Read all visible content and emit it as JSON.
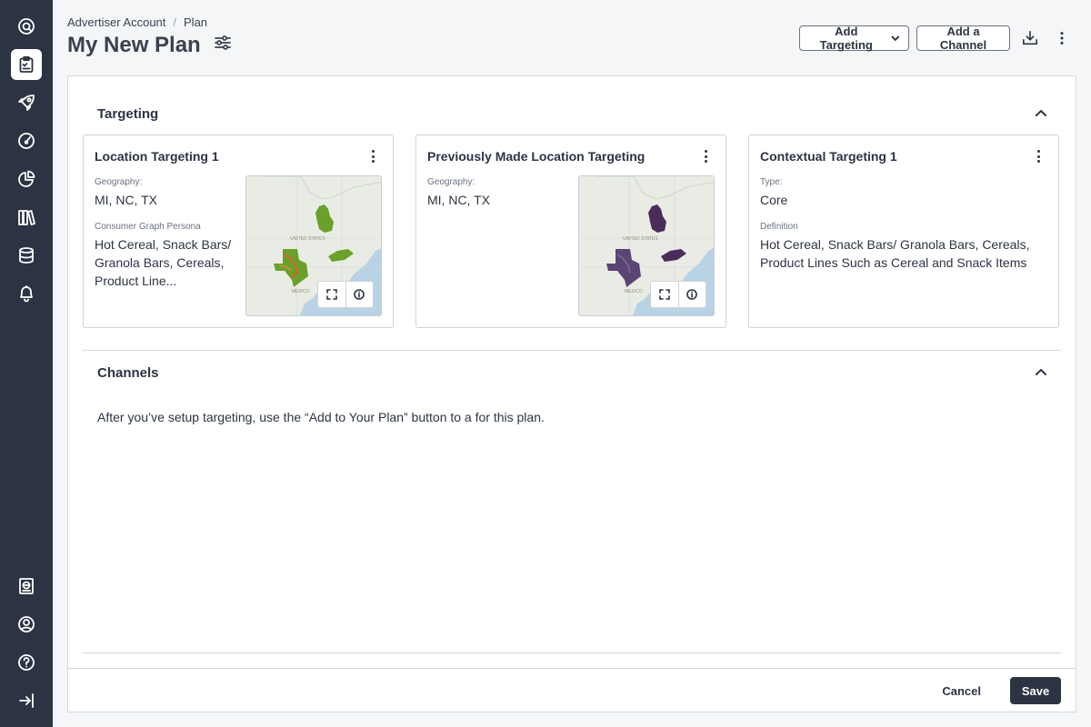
{
  "sidebar": {
    "items": [
      {
        "icon": "search-icon",
        "active": false
      },
      {
        "icon": "clipboard-icon",
        "active": true
      },
      {
        "icon": "rocket-icon",
        "active": false
      },
      {
        "icon": "gauge-icon",
        "active": false
      },
      {
        "icon": "pie-chart-icon",
        "active": false
      },
      {
        "icon": "library-icon",
        "active": false
      },
      {
        "icon": "database-icon",
        "active": false
      },
      {
        "icon": "bell-icon",
        "active": false
      },
      {
        "icon": "globe-book-icon",
        "active": false
      },
      {
        "icon": "user-icon",
        "active": false
      },
      {
        "icon": "help-icon",
        "active": false
      },
      {
        "icon": "expand-icon",
        "active": false
      }
    ]
  },
  "header": {
    "breadcrumb": [
      "Advertiser Account",
      "Plan"
    ],
    "breadcrumb_sep": "/",
    "title": "My New Plan",
    "add_targeting": "Add Targeting",
    "add_channel": "Add a Channel"
  },
  "targeting": {
    "title": "Targeting",
    "cards": [
      {
        "title": "Location Targeting 1",
        "fields": [
          {
            "label": "Geography:",
            "value": "MI, NC, TX"
          },
          {
            "label": "Consumer Graph Persona",
            "value": "Hot Cereal, Snack Bars/ Granola Bars, Cereals, Product Line..."
          }
        ],
        "map_color": "#6aa12a"
      },
      {
        "title": "Previously Made Location Targeting",
        "fields": [
          {
            "label": "Geography:",
            "value": "MI, NC, TX"
          }
        ],
        "map_color": "#4b2d5c"
      },
      {
        "title": "Contextual Targeting 1",
        "fields": [
          {
            "label": "Type:",
            "value": "Core"
          },
          {
            "label": "Definition",
            "value": "Hot Cereal, Snack Bars/ Granola Bars, Cereals, Product Lines Such as Cereal and Snack Items"
          }
        ]
      }
    ]
  },
  "channels": {
    "title": "Channels",
    "empty_text": "After you’ve setup targeting, use the “Add to Your Plan” button to a for this plan."
  },
  "footer": {
    "cancel": "Cancel",
    "save": "Save"
  },
  "map_labels": {
    "country": "UNITED STATES",
    "mexico": "MEXICO"
  }
}
